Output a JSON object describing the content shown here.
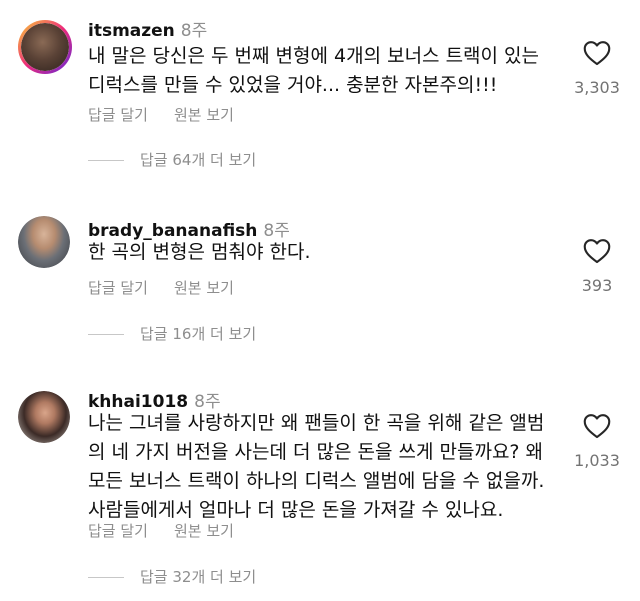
{
  "comments": [
    {
      "username": "itsmazen",
      "time": "8주",
      "text": "내 말은 당신은 두 번째 변형에 4개의 보너스 트랙이 있는 디럭스를 만들 수 있었을 거야... 충분한 자본주의!!!",
      "reply_label": "답글 달기",
      "original_label": "원본 보기",
      "likes": "3,303",
      "view_replies": "답글 64개 더 보기"
    },
    {
      "username": "brady_bananafish",
      "time": "8주",
      "text": "한 곡의 변형은 멈춰야 한다.",
      "reply_label": "답글 달기",
      "original_label": "원본 보기",
      "likes": "393",
      "view_replies": "답글 16개 더 보기"
    },
    {
      "username": "khhai1018",
      "time": "8주",
      "text": "나는 그녀를 사랑하지만 왜 팬들이 한 곡을 위해 같은 앨범의 네 가지 버전을 사는데 더 많은 돈을 쓰게 만들까요? 왜 모든 보너스 트랙이 하나의 디럭스 앨범에 담을 수 없을까. 사람들에게서 얼마나 더 많은 돈을 가져갈 수 있나요.",
      "reply_label": "답글 달기",
      "original_label": "원본 보기",
      "likes": "1,033",
      "view_replies": "답글 32개 더 보기"
    }
  ],
  "icons": {
    "like": "heart-outline-icon"
  },
  "colors": {
    "muted": "#8e8e8e",
    "story_ring": [
      "#f9ce34",
      "#ee2a7b",
      "#6228d7"
    ]
  }
}
